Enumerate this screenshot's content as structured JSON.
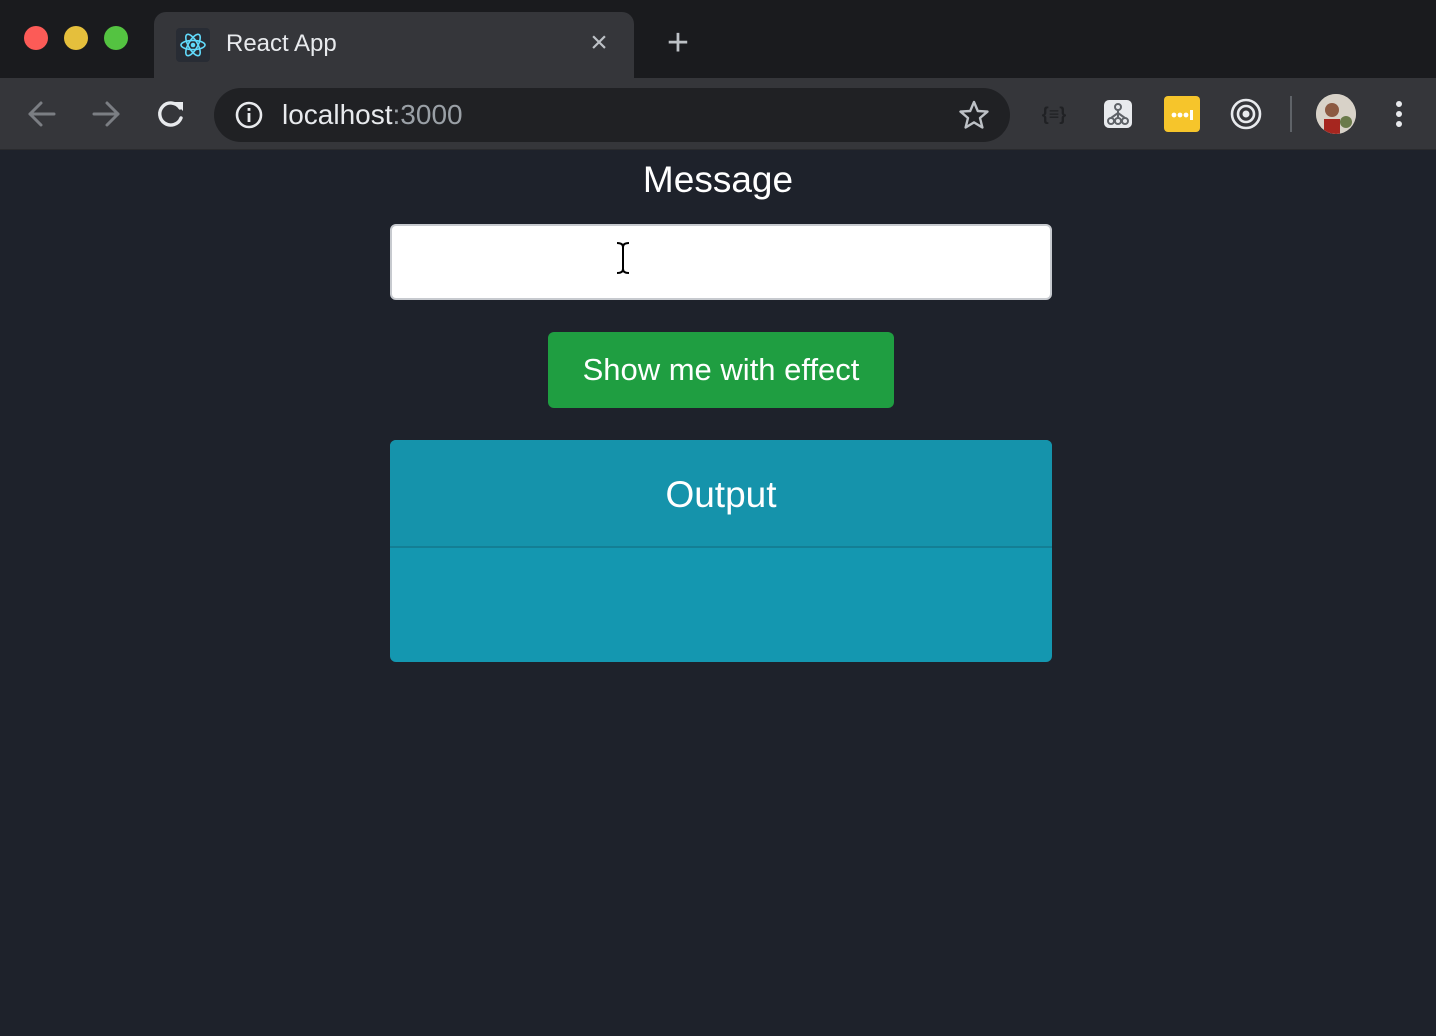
{
  "browser": {
    "tab": {
      "title": "React App",
      "close_glyph": "×",
      "favicon": "react-atom-icon"
    },
    "new_tab_glyph": "+",
    "address": {
      "host": "localhost",
      "port": ":3000"
    },
    "extensions": {
      "json_viewer": "{≡}"
    }
  },
  "app": {
    "message_label": "Message",
    "message_value": "",
    "button_label": "Show me with effect",
    "output_title": "Output",
    "output_text": ""
  },
  "colors": {
    "page_bg": "#1e222b",
    "button_green": "#1f9e41",
    "card_teal": "#1497b0"
  }
}
